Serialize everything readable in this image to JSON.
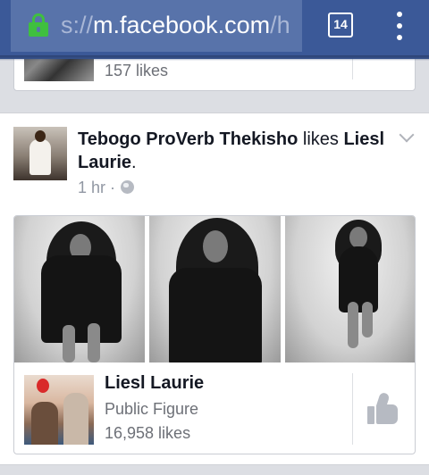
{
  "browser": {
    "url_scheme": "s://",
    "url_host": "m.facebook.com",
    "url_path": "/h",
    "tab_count": "14",
    "icons": {
      "lock": "lock-icon",
      "tabs": "tabs-icon",
      "menu": "overflow-menu-icon"
    },
    "colors": {
      "toolbar": "#3b5998",
      "urlbar": "#5873aa",
      "secure": "#3fbf3f"
    }
  },
  "previous_story": {
    "likes_text": "157 likes"
  },
  "story": {
    "actor": "Tebogo ProVerb Thekisho",
    "verb": "likes",
    "target": "Liesl Laurie",
    "suffix": ".",
    "time": "1 hr",
    "separator": "·",
    "privacy_icon": "globe-icon",
    "attachment": {
      "page_name": "Liesl Laurie",
      "category": "Public Figure",
      "likes_text": "16,958 likes",
      "like_icon": "thumbs-up-icon"
    }
  }
}
